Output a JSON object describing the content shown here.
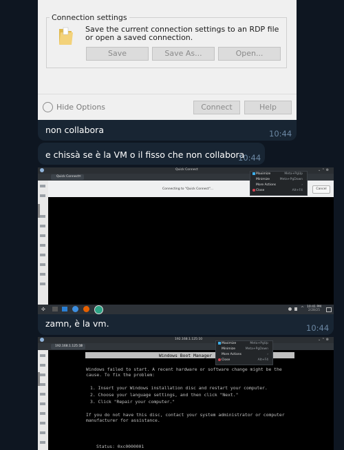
{
  "rdp_dialog": {
    "group_title": "Connection settings",
    "description": "Save the current connection settings to an RDP file or open a saved connection.",
    "save_label": "Save",
    "save_as_label": "Save As...",
    "open_label": "Open...",
    "hide_options_label": "Hide Options",
    "connect_label": "Connect",
    "help_label": "Help"
  },
  "messages": [
    {
      "text": "non collabora",
      "time": "10:44"
    },
    {
      "text": "e chissà se è la VM o il fisso che non collabora",
      "time": "10:44"
    },
    {
      "text": "zamn, è la vm.",
      "time": "10:44"
    }
  ],
  "screenshot1": {
    "window_title": "Quick Connect",
    "tab_label": "Quick Connect",
    "status_text": "Connecting to \"Quick Connect\"...",
    "cancel_label": "Cancel",
    "context_menu": [
      {
        "label": "Maximize",
        "shortcut": "Meta+PgUp"
      },
      {
        "label": "Minimize",
        "shortcut": "Meta+PgDown"
      },
      {
        "label": "More Actions",
        "shortcut": ""
      },
      {
        "label": "Close",
        "shortcut": "Alt+F4"
      }
    ],
    "clock_time": "10:41 PM",
    "clock_date": "2/28/25"
  },
  "screenshot2": {
    "window_title": "192.168.1.125:10",
    "tab_label": "192.168.1.125:10",
    "boot_manager_title": "Windows Boot Manager",
    "context_menu": [
      {
        "label": "Maximize",
        "shortcut": "Meta+PgUp"
      },
      {
        "label": "Minimize",
        "shortcut": "Meta+PgDown"
      },
      {
        "label": "More Actions",
        "shortcut": ""
      },
      {
        "label": "Close",
        "shortcut": "Alt+F4"
      }
    ],
    "line1": "Windows failed to start. A recent hardware or software change might be the",
    "line2": "cause. To fix the problem:",
    "step1": "1. Insert your Windows installation disc and restart your computer.",
    "step2": "2. Choose your language settings, and then click \"Next.\"",
    "step3": "3. Click \"Repair your computer.\"",
    "line3": "If you do not have this disc, contact your system administrator or computer",
    "line4": "manufacturer for assistance.",
    "status": "Status: 0xc0000001"
  }
}
